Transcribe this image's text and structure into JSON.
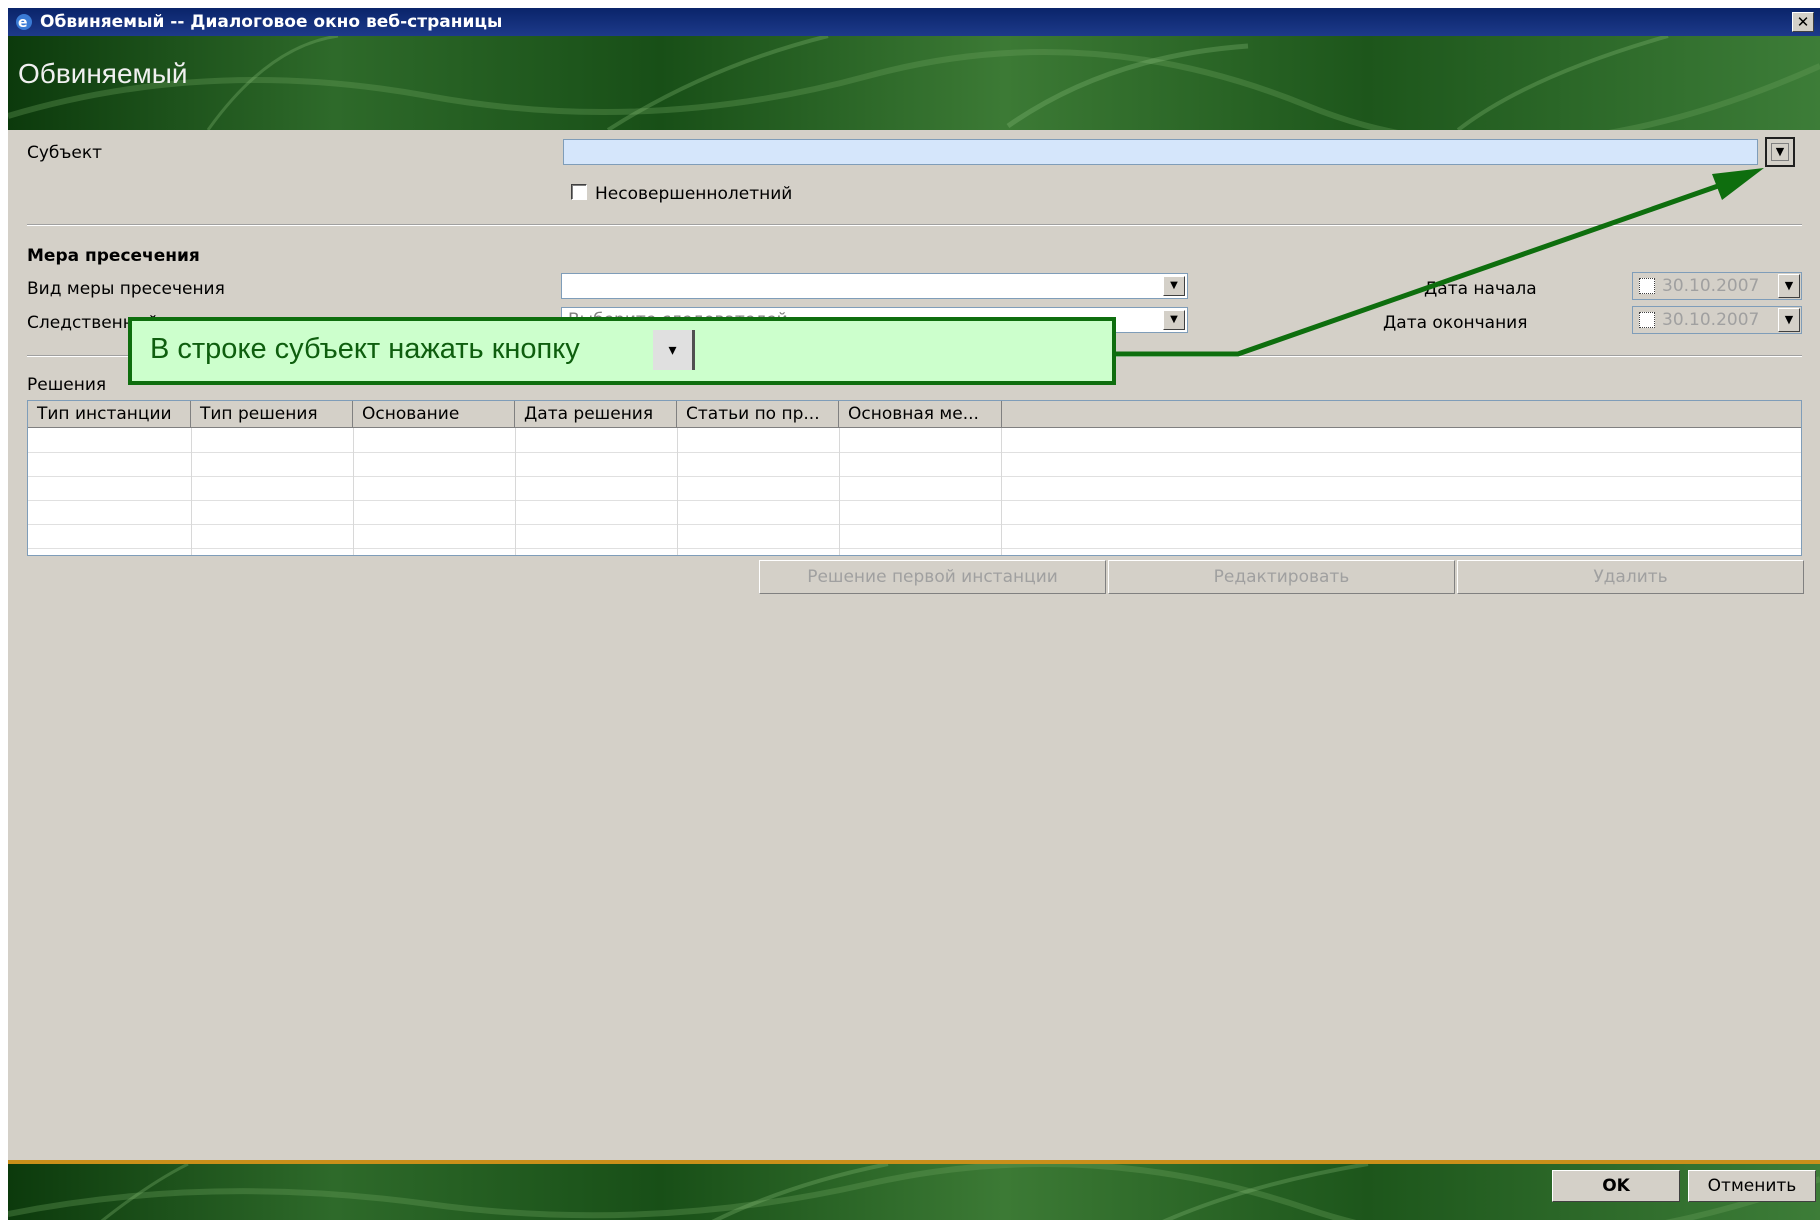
{
  "window": {
    "title": "Обвиняемый -- Диалоговое окно веб-страницы",
    "close_glyph": "✕"
  },
  "header": {
    "title": "Обвиняемый"
  },
  "subject": {
    "label": "Субъект",
    "value": "",
    "dropdown_icon": "chevron-down-icon",
    "minor_label": "Несовершеннолетний",
    "minor_checked": false
  },
  "measure": {
    "section_title": "Мера пресечения",
    "type_label": "Вид меры пресечения",
    "type_value": "",
    "investigator_label": "Следственный",
    "investigator_value": "Выберите следователей",
    "start_label": "Дата начала",
    "start_value": "30.10.2007",
    "end_label": "Дата окончания",
    "end_value": "30.10.2007"
  },
  "decisions": {
    "section_title": "Решения",
    "columns": [
      "Тип инстанции",
      "Тип решения",
      "Основание",
      "Дата решения",
      "Статьи по пр...",
      "Основная ме..."
    ],
    "rows": []
  },
  "actions": {
    "first_instance": "Решение первой инстанции",
    "edit": "Редактировать",
    "delete": "Удалить"
  },
  "footer": {
    "ok": "OK",
    "cancel": "Отменить"
  },
  "callout": {
    "text": "В строке субъект нажать кнопку",
    "button_glyph": "▾"
  },
  "colors": {
    "accent_green": "#0e6e0e",
    "callout_bg": "#ccffcc",
    "input_highlight": "#d5e6fb",
    "titlebar": "#0a246a"
  }
}
